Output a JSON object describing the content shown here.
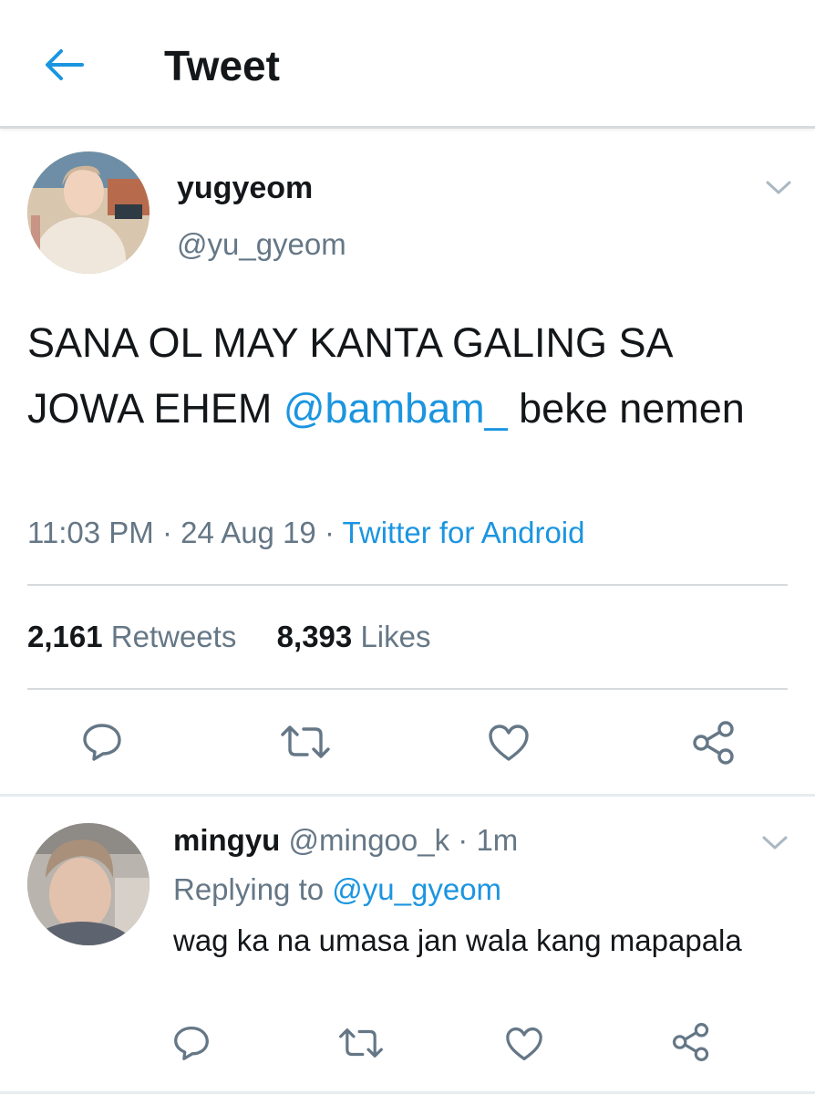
{
  "header": {
    "title": "Tweet",
    "back_icon": "arrow-left-icon"
  },
  "colors": {
    "accent": "#1b95e0",
    "text": "#14171a",
    "muted": "#657786",
    "divider": "#d7dadd"
  },
  "tweet": {
    "author_name": "yugyeom",
    "author_handle": "@yu_gyeom",
    "text_before": "SANA OL MAY KANTA GALING SA JOWA EHEM ",
    "mention": "@bambam_",
    "text_after": " beke nemen",
    "time": "11:03 PM",
    "date": "24 Aug 19",
    "source": "Twitter for Android",
    "retweet_count": "2,161",
    "retweet_label": "Retweets",
    "like_count": "8,393",
    "like_label": "Likes"
  },
  "reply": {
    "author_name": "mingyu",
    "author_handle": "@mingoo_k",
    "age": "1m",
    "replying_label": "Replying to",
    "replying_to": "@yu_gyeom",
    "text": "wag ka na umasa jan wala kang mapapala"
  }
}
